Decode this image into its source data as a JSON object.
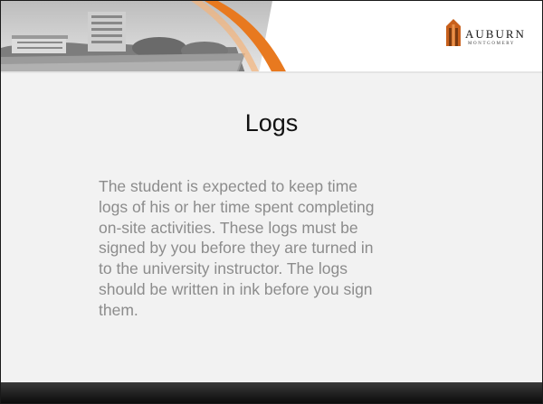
{
  "slide": {
    "title": "Logs",
    "body_lines": [
      "The student is expected to keep time",
      "logs of his or her time spent completing",
      "on-site activities. These logs must be",
      "signed by you before they are turned in",
      "to the university instructor. The logs",
      "should be written in ink before you sign",
      "them."
    ]
  },
  "logo": {
    "name": "AUBURN",
    "subtitle": "MONTGOMERY",
    "icon": "tower-icon"
  },
  "colors": {
    "accent": "#e8791f",
    "footer": "#111111",
    "body_text": "#8c8c8c",
    "background": "#f2f2f2"
  }
}
